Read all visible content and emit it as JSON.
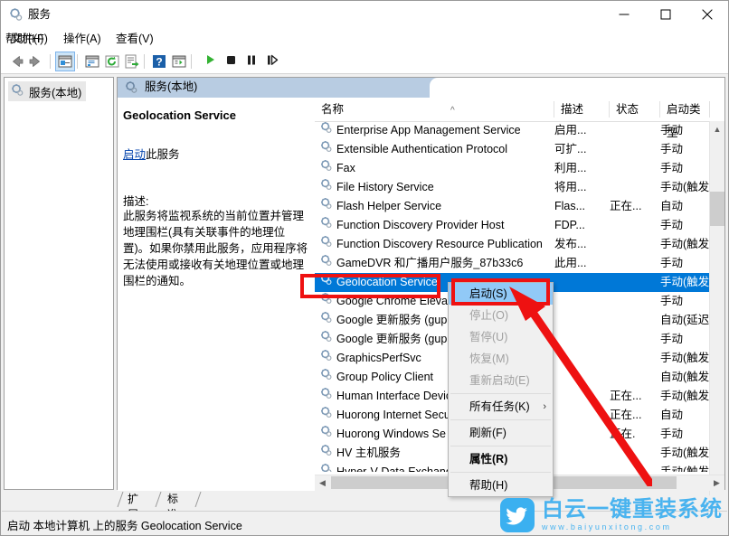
{
  "window": {
    "title": "服务",
    "title_icon": "services-gear-icon",
    "minimize_label": "最小化",
    "maximize_label": "最大化",
    "close_label": "关闭"
  },
  "menubar": {
    "items": [
      {
        "label": "文件(F)",
        "name": "menu-file"
      },
      {
        "label": "操作(A)",
        "name": "menu-action"
      },
      {
        "label": "查看(V)",
        "name": "menu-view"
      },
      {
        "label": "帮助(H)",
        "name": "menu-help"
      }
    ]
  },
  "toolbar": {
    "buttons": [
      {
        "name": "back-icon",
        "glyph": "back"
      },
      {
        "name": "forward-icon",
        "glyph": "forward"
      },
      {
        "name": "show-hide-console-tree-icon",
        "glyph": "tree"
      },
      {
        "name": "show-hide-action-pane-icon",
        "glyph": "pane"
      },
      {
        "name": "refresh-icon",
        "glyph": "refresh"
      },
      {
        "name": "export-list-icon",
        "glyph": "export"
      },
      {
        "name": "help-icon",
        "glyph": "help"
      },
      {
        "name": "properties-icon",
        "glyph": "props"
      },
      {
        "name": "start-service-icon",
        "glyph": "play"
      },
      {
        "name": "stop-service-icon",
        "glyph": "stop"
      },
      {
        "name": "pause-service-icon",
        "glyph": "pause"
      },
      {
        "name": "restart-service-icon",
        "glyph": "restart"
      }
    ]
  },
  "tree": {
    "root_label": "服务(本地)",
    "root_icon": "services-gear-icon"
  },
  "pane_header": {
    "label": "服务(本地)",
    "icon": "services-gear-icon"
  },
  "detail": {
    "service_name": "Geolocation Service",
    "action_link": "启动",
    "action_suffix": "此服务",
    "description_label": "描述:",
    "description": "此服务将监视系统的当前位置并管理地理围栏(具有关联事件的地理位置)。如果你禁用此服务，应用程序将无法使用或接收有关地理位置或地理围栏的通知。"
  },
  "list": {
    "columns": [
      {
        "label": "名称",
        "name": "column-name",
        "sorted": true,
        "sort_caret": "^"
      },
      {
        "label": "描述",
        "name": "column-description"
      },
      {
        "label": "状态",
        "name": "column-status"
      },
      {
        "label": "启动类型",
        "name": "column-startup-type"
      }
    ],
    "rows": [
      {
        "name": "Enterprise App Management Service",
        "desc": "启用...",
        "status": "",
        "startup": "手动"
      },
      {
        "name": "Extensible Authentication Protocol",
        "desc": "可扩...",
        "status": "",
        "startup": "手动"
      },
      {
        "name": "Fax",
        "desc": "利用...",
        "status": "",
        "startup": "手动"
      },
      {
        "name": "File History Service",
        "desc": "将用...",
        "status": "",
        "startup": "手动(触发..."
      },
      {
        "name": "Flash Helper Service",
        "desc": "Flas...",
        "status": "正在...",
        "startup": "自动"
      },
      {
        "name": "Function Discovery Provider Host",
        "desc": "FDP...",
        "status": "",
        "startup": "手动"
      },
      {
        "name": "Function Discovery Resource Publication",
        "desc": "发布...",
        "status": "",
        "startup": "手动(触发..."
      },
      {
        "name": "GameDVR 和广播用户服务_87b33c6",
        "desc": "此用...",
        "status": "",
        "startup": "手动"
      },
      {
        "name": "Geolocation Service",
        "desc": "",
        "status": "",
        "startup": "手动(触发...",
        "selected": true
      },
      {
        "name": "Google Chrome Elevat",
        "desc": "",
        "status": "",
        "startup": "手动"
      },
      {
        "name": "Google 更新服务 (gup",
        "desc": "",
        "status": "",
        "startup": "自动(延迟..."
      },
      {
        "name": "Google 更新服务 (gup",
        "desc": "",
        "status": "",
        "startup": "手动"
      },
      {
        "name": "GraphicsPerfSvc",
        "desc": "",
        "status": "",
        "startup": "手动(触发..."
      },
      {
        "name": "Group Policy Client",
        "desc": "",
        "status": "",
        "startup": "自动(触发..."
      },
      {
        "name": "Human Interface Devic",
        "desc": "",
        "status": "正在...",
        "startup": "手动(触发..."
      },
      {
        "name": "Huorong Internet Secu",
        "desc": "",
        "status": "正在...",
        "startup": "自动"
      },
      {
        "name": "Huorong Windows Se",
        "desc": "",
        "status": "正在.",
        "startup": "手动"
      },
      {
        "name": "HV 主机服务",
        "desc": "",
        "status": "",
        "startup": "手动(触发..."
      },
      {
        "name": "Hyper-V Data Exchang",
        "desc": "",
        "status": "",
        "startup": "手动(触发..."
      }
    ]
  },
  "context_menu": {
    "items": [
      {
        "label": "启动(S)",
        "name": "context-menu-start",
        "state": "highlighted"
      },
      {
        "label": "停止(O)",
        "name": "context-menu-stop",
        "state": "disabled"
      },
      {
        "label": "暂停(U)",
        "name": "context-menu-pause",
        "state": "disabled"
      },
      {
        "label": "恢复(M)",
        "name": "context-menu-resume",
        "state": "disabled"
      },
      {
        "label": "重新启动(E)",
        "name": "context-menu-restart",
        "state": "disabled"
      },
      {
        "separator": true
      },
      {
        "label": "所有任务(K)",
        "name": "context-menu-all-tasks",
        "state": "normal",
        "submenu": "›"
      },
      {
        "separator": true
      },
      {
        "label": "刷新(F)",
        "name": "context-menu-refresh",
        "state": "normal"
      },
      {
        "separator": true
      },
      {
        "label": "属性(R)",
        "name": "context-menu-properties",
        "state": "bold"
      },
      {
        "separator": true
      },
      {
        "label": "帮助(H)",
        "name": "context-menu-help",
        "state": "normal"
      }
    ]
  },
  "tabs": [
    {
      "label": "扩展",
      "name": "tab-extended",
      "active": false
    },
    {
      "label": "标准",
      "name": "tab-standard",
      "active": true
    }
  ],
  "statusbar": {
    "text": "启动 本地计算机 上的服务 Geolocation Service"
  },
  "watermark": {
    "main": "白云一键重装系统",
    "sub": "www.baiyunxitong.com",
    "color": "#49b3ef",
    "badge_color": "#3bb0f0",
    "badge_icon": "twitter-bird-icon"
  },
  "colors": {
    "selection_blue": "#0078d7",
    "pane_header_blue": "#b8cce2",
    "menu_highlight": "#91c9f7",
    "annotation_red": "#ee1111",
    "link_blue": "#0645ad"
  }
}
